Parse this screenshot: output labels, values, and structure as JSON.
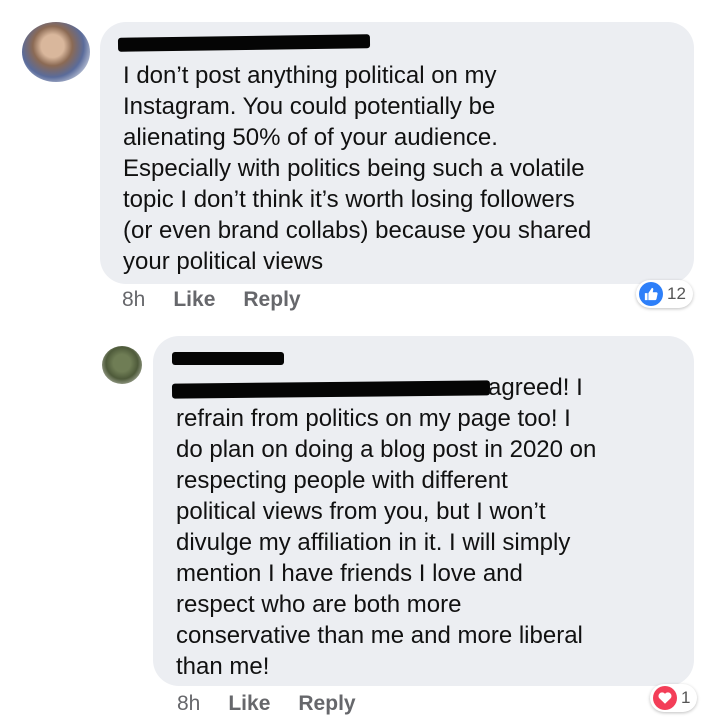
{
  "comments": [
    {
      "text": "I don’t post anything political on my\nInstagram. You could potentially be\nalienating 50% of of your audience.\nEspecially with politics being such a volatile\ntopic I don’t think it’s worth losing followers\n(or even brand collabs) because you shared\nyour political views",
      "time": "8h",
      "like_label": "Like",
      "reply_label": "Reply",
      "reaction": {
        "icon": "thumbs-up-icon",
        "count": "12",
        "color": "#2d7ff9"
      }
    },
    {
      "text": "agreed! I\nrefrain from politics on my page too! I\ndo plan on doing a blog post in 2020 on\nrespecting people with different\npolitical views from you, but I won’t\ndivulge my affiliation in it. I will simply\nmention I have friends I love and\nrespect who are both more\nconservative than me and more liberal\nthan me!",
      "time": "8h",
      "like_label": "Like",
      "reply_label": "Reply",
      "reaction": {
        "icon": "heart-icon",
        "count": "1",
        "color": "#f33e58"
      }
    }
  ],
  "colors": {
    "bubble": "#eceef2",
    "meta_text": "#66676b"
  }
}
